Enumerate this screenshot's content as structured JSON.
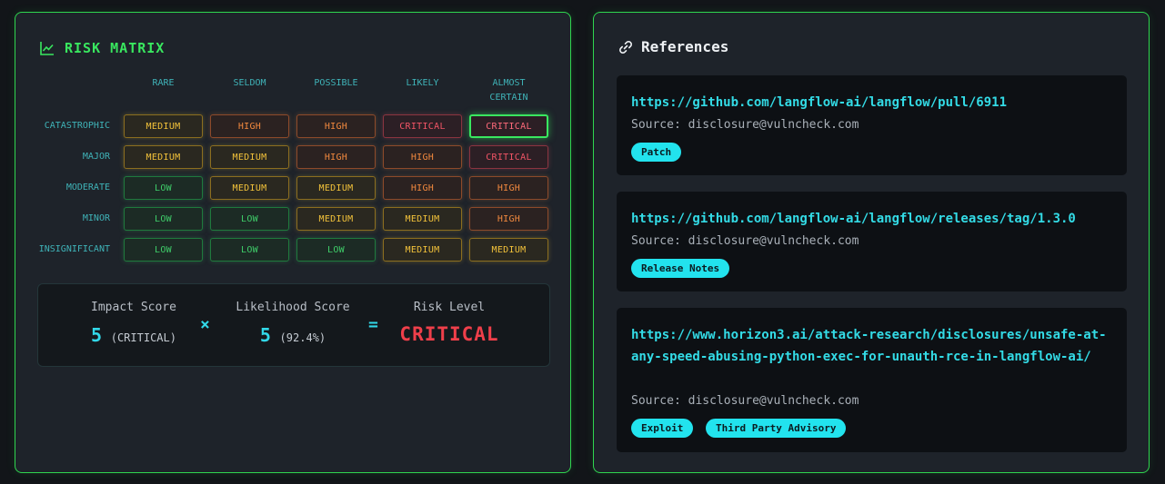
{
  "risk_matrix": {
    "title": "RISK MATRIX",
    "icon": "chart-line-icon",
    "likelihood_levels": [
      "RARE",
      "SELDOM",
      "POSSIBLE",
      "LIKELY",
      "ALMOST CERTAIN"
    ],
    "impact_levels": [
      "CATASTROPHIC",
      "MAJOR",
      "MODERATE",
      "MINOR",
      "INSIGNIFICANT"
    ],
    "cells": [
      [
        "MEDIUM",
        "HIGH",
        "HIGH",
        "CRITICAL",
        "CRITICAL"
      ],
      [
        "MEDIUM",
        "MEDIUM",
        "HIGH",
        "HIGH",
        "CRITICAL"
      ],
      [
        "LOW",
        "MEDIUM",
        "MEDIUM",
        "HIGH",
        "HIGH"
      ],
      [
        "LOW",
        "LOW",
        "MEDIUM",
        "MEDIUM",
        "HIGH"
      ],
      [
        "LOW",
        "LOW",
        "LOW",
        "MEDIUM",
        "MEDIUM"
      ]
    ],
    "selected_cell": {
      "row": 0,
      "col": 4
    },
    "colors": {
      "low": "#3fcf6a",
      "medium": "#f2c23a",
      "high": "#f0883e",
      "critical": "#f25566",
      "accent": "#39e75f"
    }
  },
  "score": {
    "impact_label": "Impact Score",
    "impact_value": "5",
    "impact_detail": "(CRITICAL)",
    "times_symbol": "×",
    "likelihood_label": "Likelihood Score",
    "likelihood_value": "5",
    "likelihood_detail": "(92.4%)",
    "equals_symbol": "=",
    "risk_label": "Risk Level",
    "risk_value": "CRITICAL"
  },
  "references": {
    "title": "References",
    "icon": "link-icon",
    "source_prefix": "Source:",
    "items": [
      {
        "url": "https://github.com/langflow-ai/langflow/pull/6911",
        "source": "disclosure@vulncheck.com",
        "tags": [
          "Patch"
        ]
      },
      {
        "url": "https://github.com/langflow-ai/langflow/releases/tag/1.3.0",
        "source": "disclosure@vulncheck.com",
        "tags": [
          "Release Notes"
        ]
      },
      {
        "url": "https://www.horizon3.ai/attack-research/disclosures/unsafe-at-any-speed-abusing-python-exec-for-unauth-rce-in-langflow-ai/",
        "source": "disclosure@vulncheck.com",
        "tags": [
          "Exploit",
          "Third Party Advisory"
        ]
      }
    ]
  }
}
